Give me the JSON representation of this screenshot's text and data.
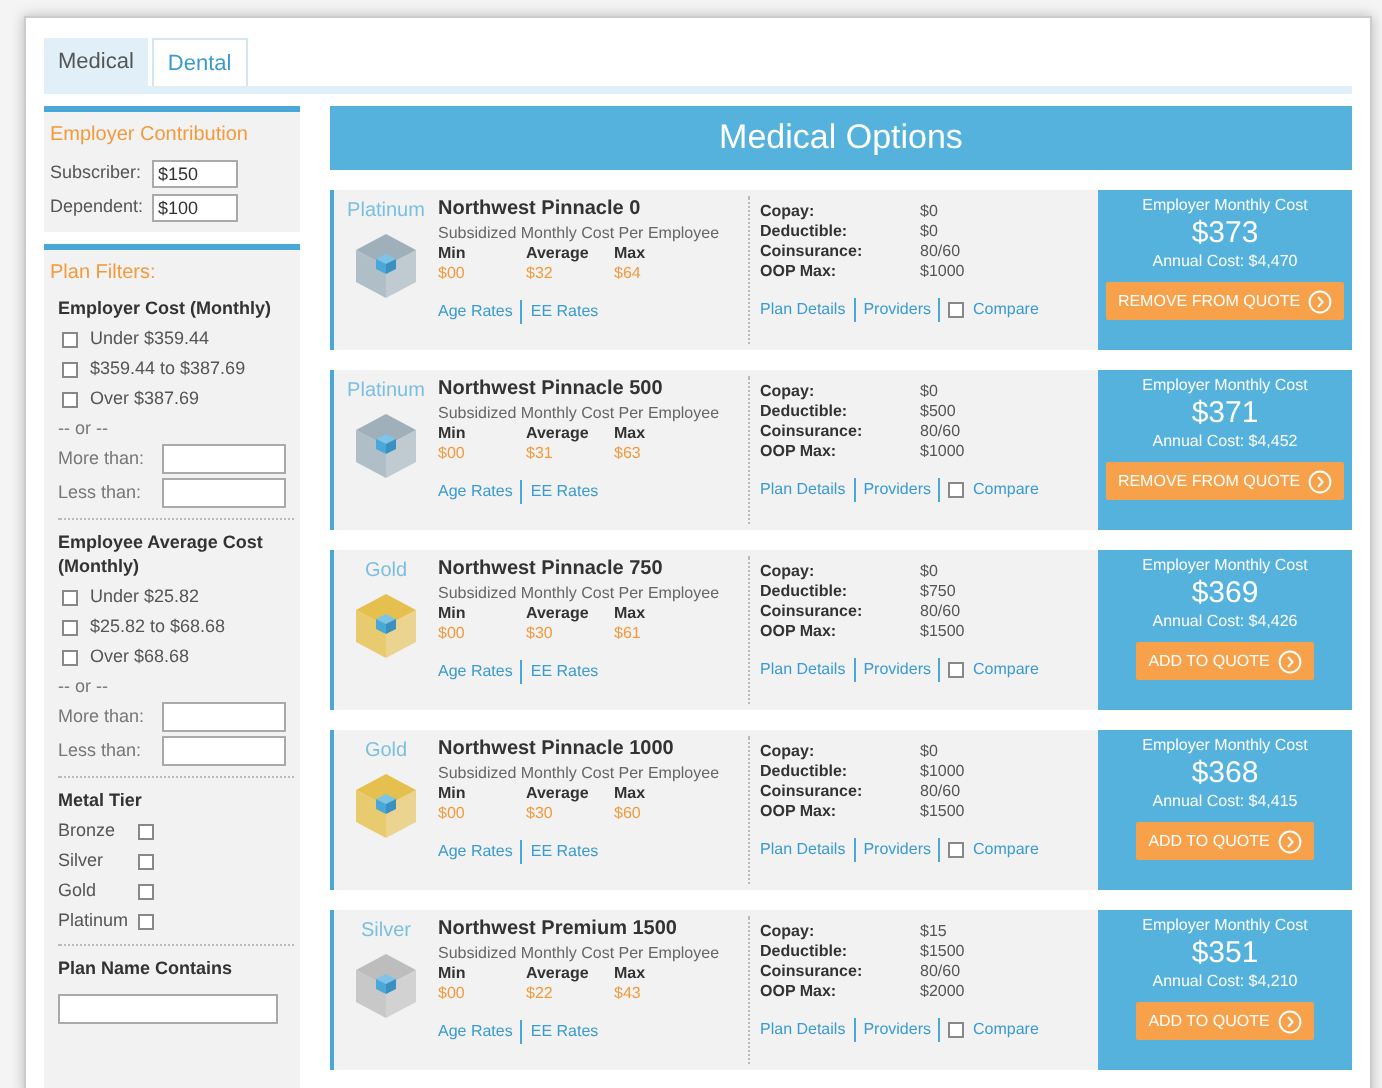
{
  "tabs": [
    {
      "label": "Medical",
      "selected": true
    },
    {
      "label": "Dental",
      "selected": false
    }
  ],
  "sidebar": {
    "contribution": {
      "title": "Employer Contribution",
      "fields": [
        {
          "label": "Subscriber:",
          "value": "$150"
        },
        {
          "label": "Dependent:",
          "value": "$100"
        }
      ]
    },
    "filters_title": "Plan Filters:",
    "employer_cost": {
      "title": "Employer Cost (Monthly)",
      "options": [
        {
          "label": "Under $359.44",
          "checked": false
        },
        {
          "label": "$359.44 to $387.69",
          "checked": false
        },
        {
          "label": "Over $387.69",
          "checked": false
        }
      ],
      "or": "-- or --",
      "more": "More than:",
      "less": "Less than:"
    },
    "employee_cost": {
      "title": "Employee Average Cost (Monthly)",
      "options": [
        {
          "label": "Under $25.82",
          "checked": false
        },
        {
          "label": "$25.82 to $68.68",
          "checked": false
        },
        {
          "label": "Over $68.68",
          "checked": false
        }
      ],
      "or": "-- or --",
      "more": "More than:",
      "less": "Less than:"
    },
    "metal_tier": {
      "title": "Metal Tier",
      "options": [
        {
          "label": "Bronze",
          "checked": false
        },
        {
          "label": "Silver",
          "checked": false
        },
        {
          "label": "Gold",
          "checked": false
        },
        {
          "label": "Platinum",
          "checked": false
        }
      ]
    },
    "plan_name": {
      "title": "Plan Name Contains"
    }
  },
  "main": {
    "title": "Medical Options",
    "plans": [
      {
        "tier": "Platinum",
        "color": "#9fb0bb",
        "name": "Northwest Pinnacle 0",
        "subtitle": "Subsidized Monthly Cost Per Employee",
        "min": "$00",
        "average": "$32",
        "max": "$64",
        "min_label": "Min",
        "average_label": "Average",
        "max_label": "Max",
        "copay": "$0",
        "deductible": "$0",
        "coinsurance": "80/60",
        "oop": "$1000",
        "compare_checked": false,
        "links": [
          "Age Rates",
          "EE Rates"
        ],
        "detail_links": [
          "Plan Details",
          "Providers"
        ],
        "compare": "Compare",
        "labels": [
          "Copay:",
          "Deductible:",
          "Coinsurance:",
          "OOP Max:"
        ],
        "cost_title": "Employer Monthly Cost",
        "cost": "$373",
        "annual": "Annual Cost: $4,470",
        "button": "REMOVE FROM QUOTE"
      },
      {
        "tier": "Platinum",
        "color": "#9fb0bb",
        "name": "Northwest Pinnacle 500",
        "subtitle": "Subsidized Monthly Cost Per Employee",
        "min": "$00",
        "average": "$31",
        "max": "$63",
        "min_label": "Min",
        "average_label": "Average",
        "max_label": "Max",
        "copay": "$0",
        "deductible": "$500",
        "coinsurance": "80/60",
        "oop": "$1000",
        "compare_checked": false,
        "links": [
          "Age Rates",
          "EE Rates"
        ],
        "detail_links": [
          "Plan Details",
          "Providers"
        ],
        "compare": "Compare",
        "labels": [
          "Copay:",
          "Deductible:",
          "Coinsurance:",
          "OOP Max:"
        ],
        "cost_title": "Employer Monthly Cost",
        "cost": "$371",
        "annual": "Annual Cost: $4,452",
        "button": "REMOVE FROM QUOTE"
      },
      {
        "tier": "Gold",
        "color": "#e6c04e",
        "name": "Northwest Pinnacle 750",
        "subtitle": "Subsidized Monthly Cost Per Employee",
        "min": "$00",
        "average": "$30",
        "max": "$61",
        "min_label": "Min",
        "average_label": "Average",
        "max_label": "Max",
        "copay": "$0",
        "deductible": "$750",
        "coinsurance": "80/60",
        "oop": "$1500",
        "compare_checked": false,
        "links": [
          "Age Rates",
          "EE Rates"
        ],
        "detail_links": [
          "Plan Details",
          "Providers"
        ],
        "compare": "Compare",
        "labels": [
          "Copay:",
          "Deductible:",
          "Coinsurance:",
          "OOP Max:"
        ],
        "cost_title": "Employer Monthly Cost",
        "cost": "$369",
        "annual": "Annual Cost: $4,426",
        "button": "ADD TO QUOTE"
      },
      {
        "tier": "Gold",
        "color": "#e6c04e",
        "name": "Northwest Pinnacle 1000",
        "subtitle": "Subsidized Monthly Cost Per Employee",
        "min": "$00",
        "average": "$30",
        "max": "$60",
        "min_label": "Min",
        "average_label": "Average",
        "max_label": "Max",
        "copay": "$0",
        "deductible": "$1000",
        "coinsurance": "80/60",
        "oop": "$1500",
        "compare_checked": false,
        "links": [
          "Age Rates",
          "EE Rates"
        ],
        "detail_links": [
          "Plan Details",
          "Providers"
        ],
        "compare": "Compare",
        "labels": [
          "Copay:",
          "Deductible:",
          "Coinsurance:",
          "OOP Max:"
        ],
        "cost_title": "Employer Monthly Cost",
        "cost": "$368",
        "annual": "Annual Cost: $4,415",
        "button": "ADD TO QUOTE"
      },
      {
        "tier": "Silver",
        "color": "#bdbdbd",
        "name": "Northwest Premium 1500",
        "subtitle": "Subsidized Monthly Cost Per Employee",
        "min": "$00",
        "average": "$22",
        "max": "$43",
        "min_label": "Min",
        "average_label": "Average",
        "max_label": "Max",
        "copay": "$15",
        "deductible": "$1500",
        "coinsurance": "80/60",
        "oop": "$2000",
        "compare_checked": false,
        "links": [
          "Age Rates",
          "EE Rates"
        ],
        "detail_links": [
          "Plan Details",
          "Providers"
        ],
        "compare": "Compare",
        "labels": [
          "Copay:",
          "Deductible:",
          "Coinsurance:",
          "OOP Max:"
        ],
        "cost_title": "Employer Monthly Cost",
        "cost": "$351",
        "annual": "Annual Cost: $4,210",
        "button": "ADD TO QUOTE"
      }
    ]
  }
}
